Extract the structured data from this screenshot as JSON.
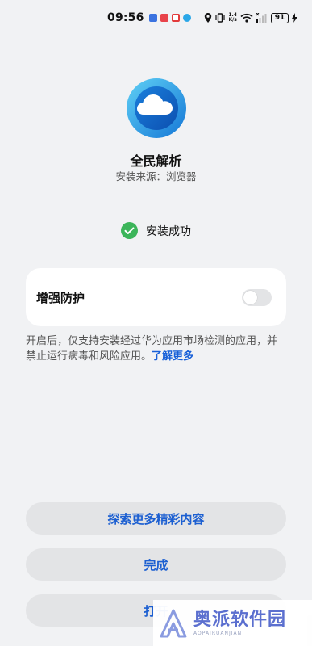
{
  "status_bar": {
    "time": "09:56",
    "net_speed_value": "1.4",
    "net_speed_unit": "K/s",
    "battery": "91"
  },
  "app": {
    "name": "全民解析",
    "source": "安装来源：浏览器"
  },
  "install": {
    "status_text": "安装成功"
  },
  "protection": {
    "label": "增强防护",
    "enabled": false,
    "description": "开启后，仅支持安装经过华为应用市场检测的应用，并禁止运行病毒和风险应用。",
    "learn_more": "了解更多"
  },
  "buttons": {
    "explore": "探索更多精彩内容",
    "done": "完成",
    "open": "打开"
  },
  "watermark": {
    "text": "奥派软件园",
    "subtext": "AOPAIRUANJIAN"
  },
  "colors": {
    "accent": "#1c5fd1",
    "link": "#1860d8",
    "success": "#3cb55a",
    "background": "#f1f2f4"
  }
}
